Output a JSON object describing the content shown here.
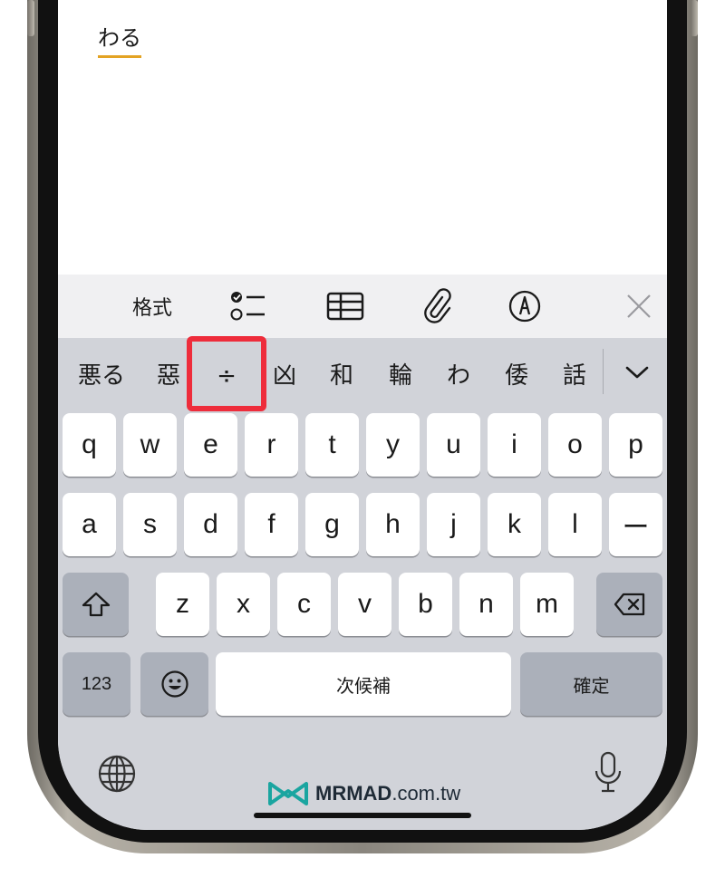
{
  "note": {
    "composing_text": "わる"
  },
  "toolbar": {
    "format_label": "格式",
    "items": [
      "checklist-icon",
      "table-icon",
      "paperclip-icon",
      "markup-pen-icon",
      "close-icon"
    ]
  },
  "candidates": {
    "items": [
      "悪る",
      "惡",
      "÷",
      "凶",
      "和",
      "輪",
      "わ",
      "倭",
      "話"
    ],
    "highlighted_index": 2,
    "highlight_color": "#ee2c3b",
    "expand_icon": "chevron-down-icon"
  },
  "keyboard": {
    "row1": [
      "q",
      "w",
      "e",
      "r",
      "t",
      "y",
      "u",
      "i",
      "o",
      "p"
    ],
    "row2": [
      "a",
      "s",
      "d",
      "f",
      "g",
      "h",
      "j",
      "k",
      "l",
      "ー"
    ],
    "row3": [
      "z",
      "x",
      "c",
      "v",
      "b",
      "n",
      "m"
    ],
    "numbers_label": "123",
    "space_label": "次候補",
    "confirm_label": "確定",
    "shift_icon": "shift-icon",
    "delete_icon": "delete-icon",
    "emoji_icon": "emoji-icon",
    "globe_icon": "globe-icon",
    "mic_icon": "microphone-icon"
  },
  "watermark": {
    "brand": "MRMAD",
    "suffix": ".com.tw"
  },
  "colors": {
    "keyboard_bg": "#d1d3d9",
    "key_bg": "#ffffff",
    "key_dark_bg": "#abb0ba",
    "underline": "#e3a323",
    "watermark_accent": "#1aa5a0"
  }
}
